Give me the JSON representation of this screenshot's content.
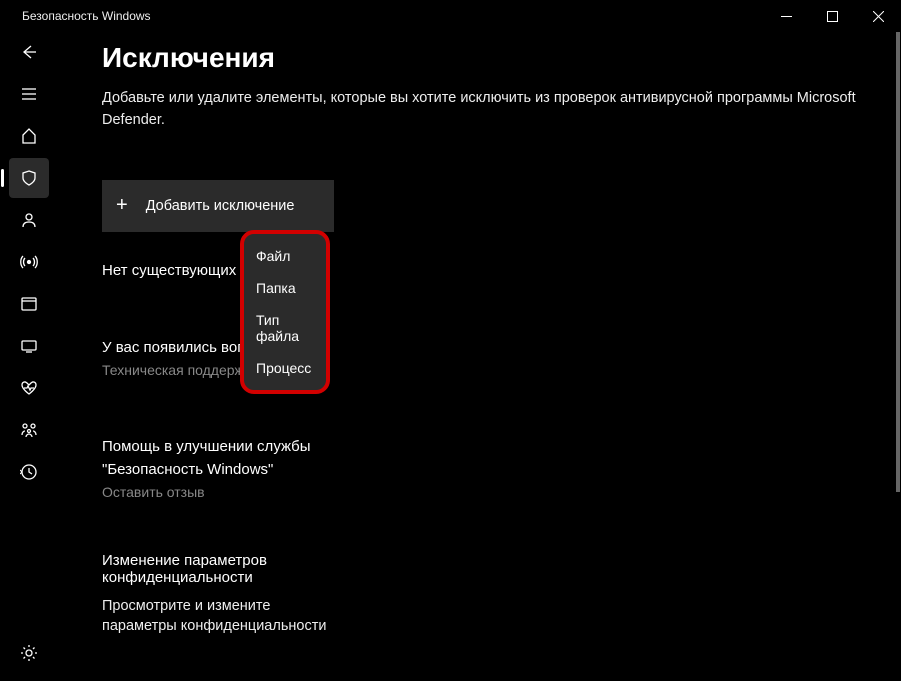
{
  "window": {
    "title": "Безопасность Windows"
  },
  "page": {
    "title": "Исключения",
    "description": "Добавьте или удалите элементы, которые вы хотите исключить из проверок антивирусной программы Microsoft Defender."
  },
  "addButton": {
    "label": "Добавить исключение"
  },
  "statusLine": "Нет существующих исключений.",
  "dropdown": {
    "items": [
      "Файл",
      "Папка",
      "Тип файла",
      "Процесс"
    ]
  },
  "questions": {
    "title": "У вас появились вопросы?",
    "link": "Техническая поддержка"
  },
  "improve": {
    "title1": "Помощь в улучшении службы",
    "title2": "\"Безопасность Windows\"",
    "link": "Оставить отзыв"
  },
  "privacy": {
    "title1": "Изменение параметров",
    "title2": "конфиденциальности",
    "desc1": "Просмотрите и измените",
    "desc2": "параметры конфиденциальности"
  }
}
